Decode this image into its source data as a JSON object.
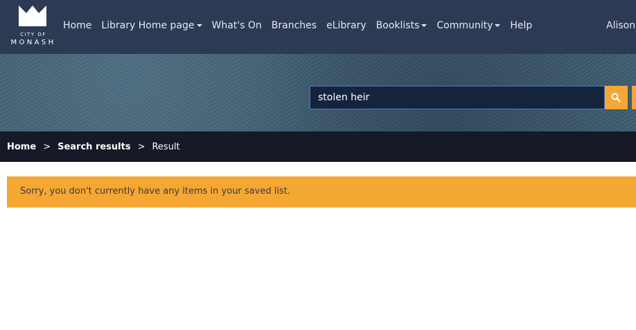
{
  "logo": {
    "city": "CITY OF",
    "name": "MONASH"
  },
  "nav": {
    "items": [
      {
        "label": "Home",
        "dropdown": false
      },
      {
        "label": "Library Home page",
        "dropdown": true
      },
      {
        "label": "What's On",
        "dropdown": false
      },
      {
        "label": "Branches",
        "dropdown": false
      },
      {
        "label": "eLibrary",
        "dropdown": false
      },
      {
        "label": "Booklists",
        "dropdown": true
      },
      {
        "label": "Community",
        "dropdown": true
      },
      {
        "label": "Help",
        "dropdown": false
      }
    ],
    "user": "Alison"
  },
  "search": {
    "value": "stolen heir",
    "icon": "search-icon"
  },
  "breadcrumb": {
    "home": "Home",
    "separator_1": ">",
    "search_results": "Search results",
    "separator_2": ">",
    "current": "Result"
  },
  "alert": {
    "message": "Sorry, you don't currently have any items in your saved list."
  },
  "colors": {
    "navbar": "#2d3a54",
    "breadcrumb_bar": "#151a26",
    "accent": "#f5a734",
    "search_field": "#15233d"
  }
}
